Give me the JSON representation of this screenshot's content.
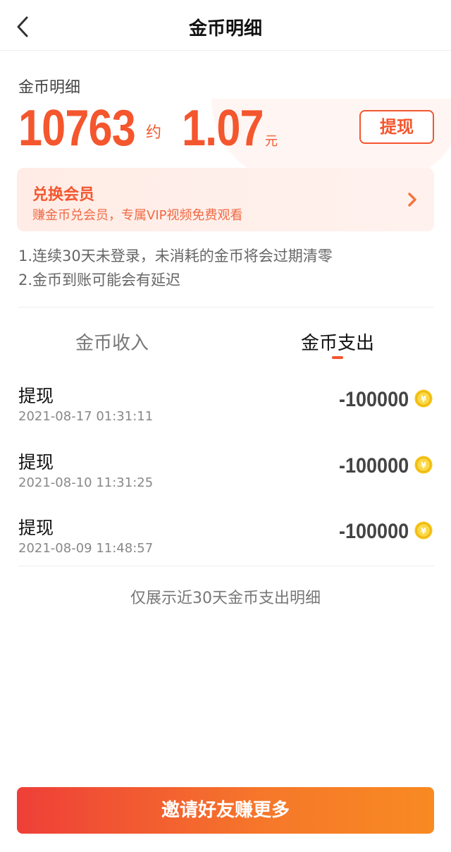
{
  "nav": {
    "title": "金币明细",
    "back_icon": "chevron-left-icon"
  },
  "summary": {
    "label": "金币明细",
    "coins": "10763",
    "approx_label": "约",
    "money": "1.07",
    "currency": "元",
    "withdraw_label": "提现"
  },
  "vip": {
    "title": "兑换会员",
    "description": "赚金币兑会员，专属VIP视频免费观看",
    "arrow_icon": "chevron-right-icon"
  },
  "notes": [
    "1.连续30天未登录，未消耗的金币将会过期清零",
    "2.金币到账可能会有延迟"
  ],
  "tabs": {
    "income": "金币收入",
    "expense": "金币支出",
    "active": "expense"
  },
  "records": [
    {
      "title": "提现",
      "time": "2021-08-17 01:31:11",
      "amount": "-100000"
    },
    {
      "title": "提现",
      "time": "2021-08-10 11:31:25",
      "amount": "-100000"
    },
    {
      "title": "提现",
      "time": "2021-08-09 11:48:57",
      "amount": "-100000"
    }
  ],
  "footer_note": "仅展示近30天金币支出明细",
  "invite_button": "邀请好友赚更多",
  "colors": {
    "accent": "#f4562e",
    "coin": "#f5c518",
    "button_gradient_start": "#ee3f38",
    "button_gradient_end": "#f88a22"
  }
}
